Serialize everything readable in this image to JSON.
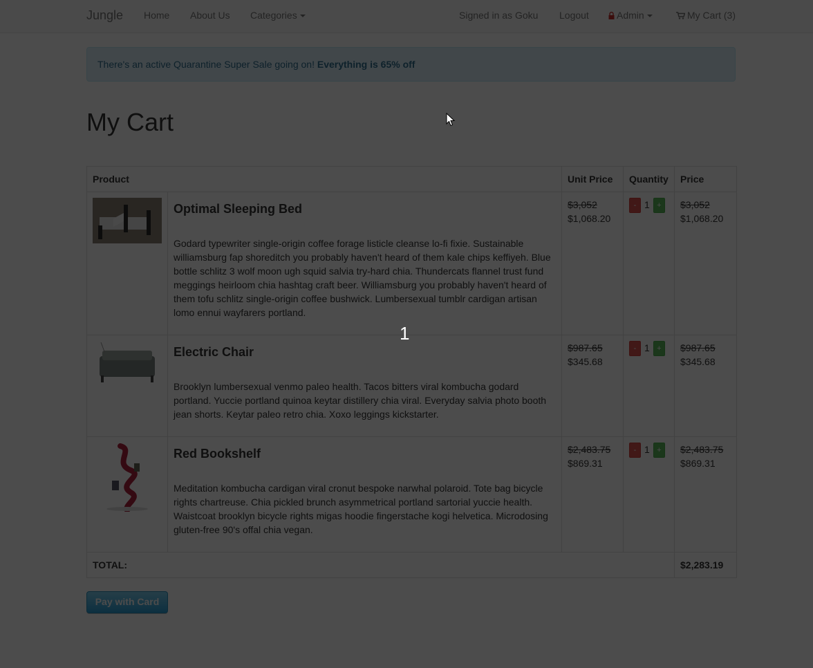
{
  "nav": {
    "brand": "Jungle",
    "home": "Home",
    "about": "About Us",
    "categories": "Categories",
    "signed_in": "Signed in as Goku",
    "logout": "Logout",
    "admin": "Admin",
    "cart": "My Cart (3)",
    "admin_icon": "lock-icon",
    "cart_icon": "shopping-cart-icon"
  },
  "alert": {
    "text": "There's an active Quarantine Super Sale going on!",
    "bold": "Everything is 65% off"
  },
  "page_title": "My Cart",
  "table": {
    "headers": {
      "product": "Product",
      "unit_price": "Unit Price",
      "quantity": "Quantity",
      "price": "Price"
    },
    "items": [
      {
        "name": "Optimal Sleeping Bed",
        "description": "Godard typewriter single-origin coffee forage listicle cleanse lo-fi fixie. Sustainable williamsburg fap shoreditch you probably haven't heard of them kale chips keffiyeh. Blue bottle schlitz 3 wolf moon ugh squid salvia try-hard chia. Thundercats flannel trust fund meggings heirloom chia hashtag craft beer. Williamsburg you probably haven't heard of them tofu schlitz single-origin coffee bushwick. Lumbersexual tumblr cardigan artisan lomo ennui wayfarers portland.",
        "unit_old": "$3,052",
        "unit_new": "$1,068.20",
        "qty": "1",
        "price_old": "$3,052",
        "price_new": "$1,068.20"
      },
      {
        "name": "Electric Chair",
        "description": "Brooklyn lumbersexual venmo paleo health. Tacos bitters viral kombucha godard portland. Yuccie portland quinoa keytar distillery chia viral. Everyday salvia photo booth jean shorts. Keytar paleo retro chia. Xoxo leggings kickstarter.",
        "unit_old": "$987.65",
        "unit_new": "$345.68",
        "qty": "1",
        "price_old": "$987.65",
        "price_new": "$345.68"
      },
      {
        "name": "Red Bookshelf",
        "description": "Meditation kombucha cardigan viral cronut bespoke narwhal polaroid. Tote bag bicycle rights chartreuse. Chia pickled brunch asymmetrical portland sartorial yuccie health. Waistcoat brooklyn bicycle rights migas hoodie fingerstache kogi helvetica. Microdosing gluten-free 90's offal chia vegan.",
        "unit_old": "$2,483.75",
        "unit_new": "$869.31",
        "qty": "1",
        "price_old": "$2,483.75",
        "price_new": "$869.31"
      }
    ],
    "total_label": "TOTAL:",
    "total_value": "$2,283.19"
  },
  "pay_button": "Pay with Card",
  "overlay_number": "1",
  "colors": {
    "alert_bg": "#d9edf7",
    "pay_button": "#2a9fd6",
    "overlay": "rgba(0,0,0,0.7)"
  }
}
